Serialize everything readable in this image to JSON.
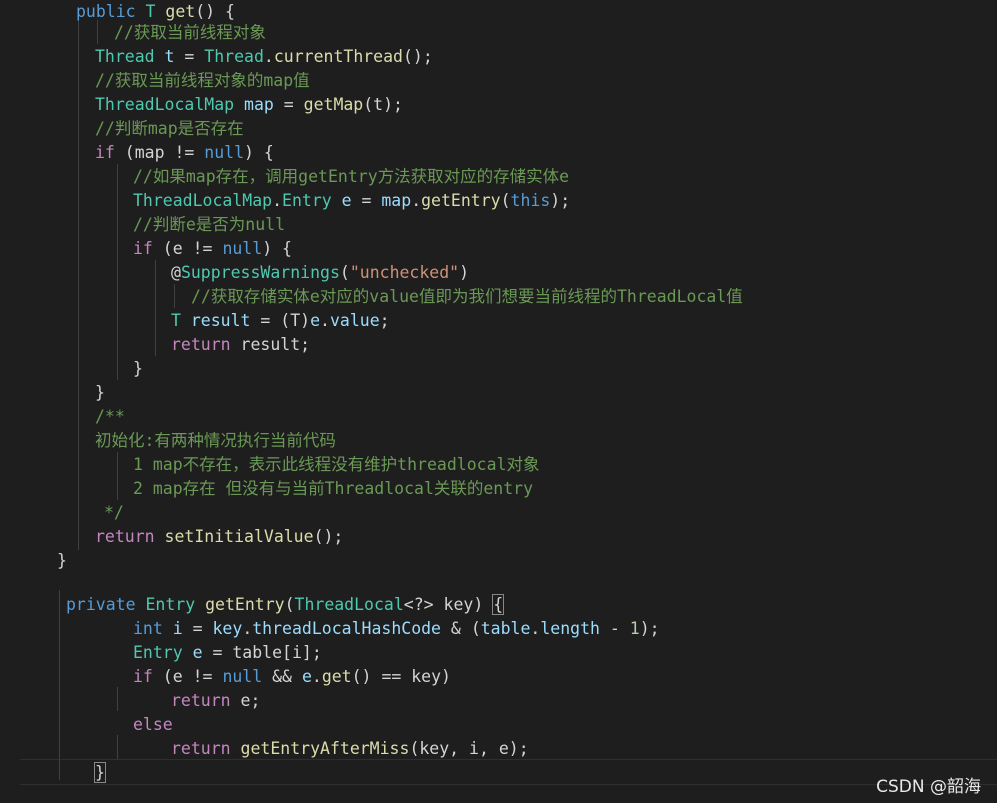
{
  "editor": {
    "lines": [
      {
        "name": "code-line-1",
        "tokens": [
          [
            "kw",
            "public"
          ],
          [
            "pu",
            " "
          ],
          [
            "ty",
            "T"
          ],
          [
            "pu",
            " "
          ],
          [
            "fn",
            "get"
          ],
          [
            "pu",
            "() {"
          ]
        ]
      },
      {
        "name": "code-line-2",
        "tokens": [
          [
            "cm",
            "//获取当前线程对象"
          ]
        ]
      },
      {
        "name": "code-line-3",
        "tokens": [
          [
            "ty",
            "Thread"
          ],
          [
            "pu",
            " "
          ],
          [
            "var",
            "t"
          ],
          [
            "op",
            " = "
          ],
          [
            "ty",
            "Thread"
          ],
          [
            "pu",
            "."
          ],
          [
            "fn",
            "currentThread"
          ],
          [
            "pu",
            "();"
          ]
        ]
      },
      {
        "name": "code-line-4",
        "tokens": [
          [
            "cm",
            "//获取当前线程对象的map值"
          ]
        ]
      },
      {
        "name": "code-line-5",
        "tokens": [
          [
            "ty",
            "ThreadLocalMap"
          ],
          [
            "pu",
            " "
          ],
          [
            "var",
            "map"
          ],
          [
            "op",
            " = "
          ],
          [
            "fn",
            "getMap"
          ],
          [
            "pu",
            "(t);"
          ]
        ]
      },
      {
        "name": "code-line-6",
        "tokens": [
          [
            "cm",
            "//判断map是否存在"
          ]
        ]
      },
      {
        "name": "code-line-7",
        "tokens": [
          [
            "ctl",
            "if"
          ],
          [
            "pu",
            " (map "
          ],
          [
            "op",
            "!="
          ],
          [
            "pu",
            " "
          ],
          [
            "kw",
            "null"
          ],
          [
            "pu",
            ") {"
          ]
        ]
      },
      {
        "name": "code-line-8",
        "tokens": [
          [
            "cm",
            "//如果map存在，调用getEntry方法获取对应的存储实体e"
          ]
        ]
      },
      {
        "name": "code-line-9",
        "tokens": [
          [
            "ty",
            "ThreadLocalMap"
          ],
          [
            "pu",
            "."
          ],
          [
            "ty",
            "Entry"
          ],
          [
            "pu",
            " "
          ],
          [
            "var",
            "e"
          ],
          [
            "op",
            " = "
          ],
          [
            "var",
            "map"
          ],
          [
            "pu",
            "."
          ],
          [
            "fn",
            "getEntry"
          ],
          [
            "pu",
            "("
          ],
          [
            "kw",
            "this"
          ],
          [
            "pu",
            ");"
          ]
        ]
      },
      {
        "name": "code-line-10",
        "tokens": [
          [
            "cm",
            "//判断e是否为null"
          ]
        ]
      },
      {
        "name": "code-line-11",
        "tokens": [
          [
            "ctl",
            "if"
          ],
          [
            "pu",
            " (e "
          ],
          [
            "op",
            "!="
          ],
          [
            "pu",
            " "
          ],
          [
            "kw",
            "null"
          ],
          [
            "pu",
            ") {"
          ]
        ]
      },
      {
        "name": "code-line-12",
        "tokens": [
          [
            "pu",
            "@"
          ],
          [
            "ty",
            "SuppressWarnings"
          ],
          [
            "pu",
            "("
          ],
          [
            "str",
            "\"unchecked\""
          ],
          [
            "pu",
            ")"
          ]
        ]
      },
      {
        "name": "code-line-13",
        "tokens": [
          [
            "cm",
            "//获取存储实体e对应的value值即为我们想要当前线程的ThreadLocal值"
          ]
        ]
      },
      {
        "name": "code-line-14",
        "tokens": [
          [
            "ty",
            "T"
          ],
          [
            "pu",
            " "
          ],
          [
            "var",
            "result"
          ],
          [
            "op",
            " = "
          ],
          [
            "pu",
            "(T)"
          ],
          [
            "var",
            "e"
          ],
          [
            "pu",
            "."
          ],
          [
            "var",
            "value"
          ],
          [
            "pu",
            ";"
          ]
        ]
      },
      {
        "name": "code-line-15",
        "tokens": [
          [
            "ctl",
            "return"
          ],
          [
            "pu",
            " result;"
          ]
        ]
      },
      {
        "name": "code-line-16",
        "tokens": [
          [
            "pu",
            "}"
          ]
        ]
      },
      {
        "name": "code-line-17",
        "tokens": [
          [
            "pu",
            "}"
          ]
        ]
      },
      {
        "name": "code-line-18",
        "tokens": [
          [
            "cm",
            "/**"
          ]
        ]
      },
      {
        "name": "code-line-19",
        "tokens": [
          [
            "cm",
            "初始化:有两种情况执行当前代码"
          ]
        ]
      },
      {
        "name": "code-line-20",
        "tokens": [
          [
            "cm",
            "1 map不存在，表示此线程没有维护threadlocal对象"
          ]
        ]
      },
      {
        "name": "code-line-21",
        "tokens": [
          [
            "cm",
            "2 map存在 但没有与当前Threadlocal关联的entry"
          ]
        ]
      },
      {
        "name": "code-line-22",
        "tokens": [
          [
            "cm",
            "*/"
          ]
        ]
      },
      {
        "name": "code-line-23",
        "tokens": [
          [
            "ctl",
            "return"
          ],
          [
            "pu",
            " "
          ],
          [
            "fn",
            "setInitialValue"
          ],
          [
            "pu",
            "();"
          ]
        ]
      },
      {
        "name": "code-line-24",
        "tokens": [
          [
            "pu",
            "}"
          ]
        ]
      },
      {
        "name": "code-line-25",
        "tokens": [
          [
            "kw",
            "private"
          ],
          [
            "pu",
            " "
          ],
          [
            "ty",
            "Entry"
          ],
          [
            "pu",
            " "
          ],
          [
            "fn",
            "getEntry"
          ],
          [
            "pu",
            "("
          ],
          [
            "ty",
            "ThreadLocal"
          ],
          [
            "pu",
            "<?> key) "
          ],
          [
            "pu",
            "{"
          ]
        ]
      },
      {
        "name": "code-line-26",
        "tokens": [
          [
            "kw",
            "int"
          ],
          [
            "pu",
            " "
          ],
          [
            "var",
            "i"
          ],
          [
            "op",
            " = "
          ],
          [
            "var",
            "key"
          ],
          [
            "pu",
            "."
          ],
          [
            "var",
            "threadLocalHashCode"
          ],
          [
            "op",
            " & "
          ],
          [
            "pu",
            "("
          ],
          [
            "var",
            "table"
          ],
          [
            "pu",
            "."
          ],
          [
            "var",
            "length"
          ],
          [
            "op",
            " - "
          ],
          [
            "num",
            "1"
          ],
          [
            "pu",
            ");"
          ]
        ]
      },
      {
        "name": "code-line-27",
        "tokens": [
          [
            "ty",
            "Entry"
          ],
          [
            "pu",
            " "
          ],
          [
            "var",
            "e"
          ],
          [
            "op",
            " = "
          ],
          [
            "pu",
            "table[i];"
          ]
        ]
      },
      {
        "name": "code-line-28",
        "tokens": [
          [
            "ctl",
            "if"
          ],
          [
            "pu",
            " (e "
          ],
          [
            "op",
            "!="
          ],
          [
            "pu",
            " "
          ],
          [
            "kw",
            "null"
          ],
          [
            "op",
            " && "
          ],
          [
            "var",
            "e"
          ],
          [
            "pu",
            "."
          ],
          [
            "fn",
            "get"
          ],
          [
            "pu",
            "() "
          ],
          [
            "op",
            "=="
          ],
          [
            "pu",
            " key)"
          ]
        ]
      },
      {
        "name": "code-line-29",
        "tokens": [
          [
            "ctl",
            "return"
          ],
          [
            "pu",
            " e;"
          ]
        ]
      },
      {
        "name": "code-line-30",
        "tokens": [
          [
            "ctl",
            "else"
          ]
        ]
      },
      {
        "name": "code-line-31",
        "tokens": [
          [
            "ctl",
            "return"
          ],
          [
            "pu",
            " "
          ],
          [
            "fn",
            "getEntryAfterMiss"
          ],
          [
            "pu",
            "(key, i, e);"
          ]
        ]
      },
      {
        "name": "code-line-32",
        "tokens": [
          [
            "pu",
            "}"
          ]
        ]
      }
    ]
  },
  "watermark": "CSDN @韶海"
}
